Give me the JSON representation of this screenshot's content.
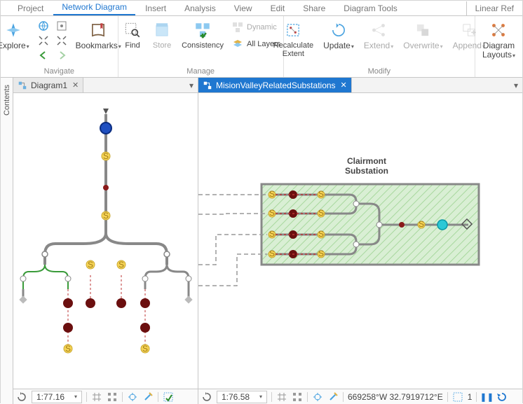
{
  "menu_tabs": [
    "Project",
    "Network Diagram",
    "Insert",
    "Analysis",
    "View",
    "Edit",
    "Share",
    "Diagram Tools",
    "Linear Ref"
  ],
  "menu_active_index": 1,
  "ribbon": {
    "navigate": {
      "explore": "Explore",
      "bookmarks": "Bookmarks",
      "group": "Navigate"
    },
    "manage": {
      "find": "Find",
      "store": "Store",
      "consistency": "Consistency",
      "dynamic": "Dynamic",
      "all_layers": "All Layers",
      "group": "Manage"
    },
    "modify": {
      "recalc": "Recalculate\nExtent",
      "update": "Update",
      "extend": "Extend",
      "overwrite": "Overwrite",
      "append": "Append",
      "group": "Modify"
    },
    "layout": {
      "layouts": "Diagram\nLayouts",
      "group": ""
    }
  },
  "contents_pane": {
    "label": "Contents"
  },
  "pane1": {
    "tab": "Diagram1",
    "scale": "1:77.16"
  },
  "pane2": {
    "tab": "MisionValleyRelatedSubstations",
    "scale": "1:76.58",
    "coords": "669258°W 32.7919712°E",
    "annotation_title": "Clairmont",
    "annotation_sub": "Substation"
  },
  "status": {
    "selected": "1"
  }
}
